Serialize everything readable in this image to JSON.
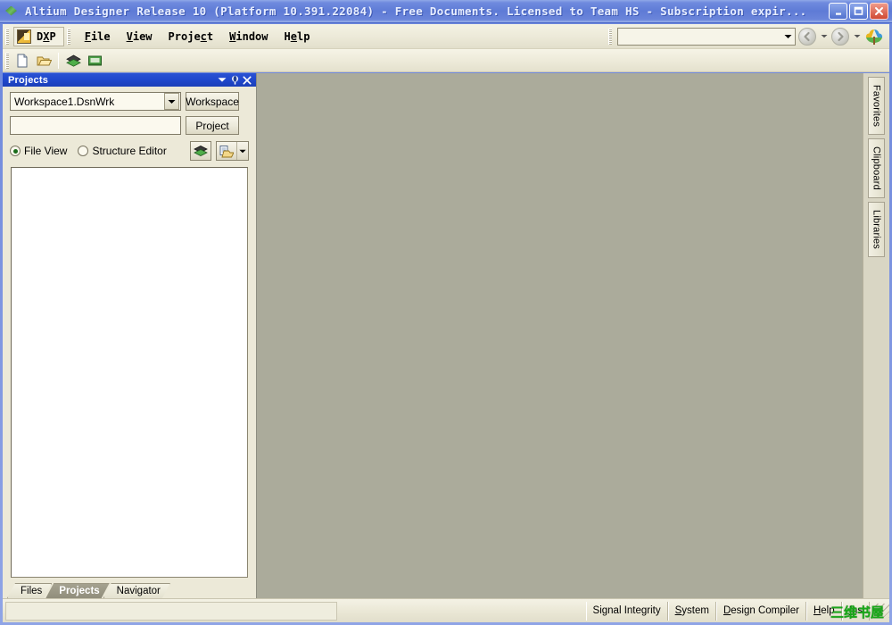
{
  "window": {
    "title": "Altium Designer Release 10 (Platform 10.391.22084) - Free Documents. Licensed to Team HS - Subscription expir...",
    "app_icon": "altium-diamond-icon",
    "controls": {
      "minimize": "minimize-button",
      "maximize": "maximize-button",
      "close": "close-button"
    }
  },
  "menubar": {
    "dxp_label": "DXP",
    "items": [
      {
        "label": "File",
        "accel": "F"
      },
      {
        "label": "View",
        "accel": "V"
      },
      {
        "label": "Project",
        "accel": "c"
      },
      {
        "label": "Window",
        "accel": "W"
      },
      {
        "label": "Help",
        "accel": "e"
      }
    ],
    "address": {
      "value": "",
      "placeholder": ""
    },
    "back_button": "back-navigation-button",
    "forward_button": "forward-navigation-button",
    "home_button": "altium-home-icon"
  },
  "toolbar": {
    "buttons": [
      {
        "name": "new-document-icon",
        "tooltip": "New"
      },
      {
        "name": "open-document-icon",
        "tooltip": "Open"
      },
      {
        "name": "pcb-layers-icon",
        "tooltip": "View PCB"
      },
      {
        "name": "device-view-icon",
        "tooltip": "Devices View"
      }
    ]
  },
  "panel": {
    "title": "Projects",
    "header_buttons": [
      {
        "name": "panel-menu-chevron-icon"
      },
      {
        "name": "panel-pin-icon"
      },
      {
        "name": "panel-close-icon"
      }
    ],
    "workspace_combo": {
      "value": "Workspace1.DsnWrk",
      "options": [
        "Workspace1.DsnWrk"
      ]
    },
    "workspace_button": "Workspace",
    "project_field": {
      "value": "",
      "placeholder": ""
    },
    "project_button": "Project",
    "view_modes": [
      {
        "label": "File View",
        "selected": true
      },
      {
        "label": "Structure Editor",
        "selected": false
      }
    ],
    "action_buttons": [
      {
        "name": "pcb-stack-icon"
      },
      {
        "name": "open-project-folder-icon"
      }
    ],
    "file_list": {
      "items": []
    },
    "tabs": [
      {
        "label": "Files",
        "active": false
      },
      {
        "label": "Projects",
        "active": true
      },
      {
        "label": "Navigator",
        "active": false
      }
    ]
  },
  "right_dock": {
    "tabs": [
      "Favorites",
      "Clipboard",
      "Libraries"
    ]
  },
  "statusbar": {
    "message": "",
    "buttons": [
      {
        "label": "Signal Integrity",
        "accel": ""
      },
      {
        "label": "System",
        "accel": "S"
      },
      {
        "label": "Design Compiler",
        "accel": "D"
      },
      {
        "label": "Help",
        "accel": "H"
      },
      {
        "label": "Ins",
        "accel": "I"
      }
    ],
    "watermark": "三维书屋"
  },
  "colors": {
    "titlebar": "#5e7bd6",
    "panel_header": "#2048cc",
    "workspace": "#abab9b",
    "chrome": "#ece9d8",
    "accent_green": "#18a818"
  }
}
